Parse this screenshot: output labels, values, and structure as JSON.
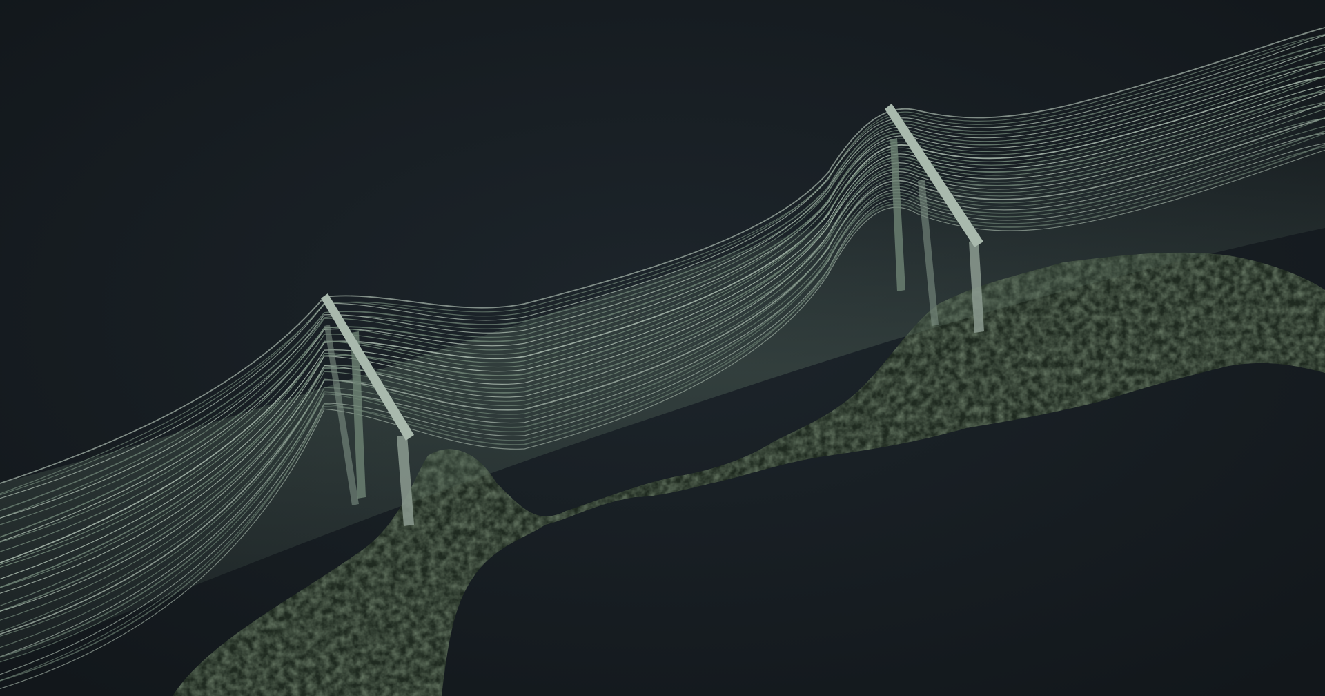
{
  "scene": {
    "subject": "wire-suspension-bridge-over-moss",
    "colors": {
      "background": "#161c21",
      "background_glow": "#1d252b",
      "moss_dark": "#1f2a20",
      "moss_mid": "#2d3b2b",
      "moss_light": "#3f5139",
      "wire": "#a9b9ad",
      "wire_dim": "#6f8476",
      "tower": "#8d9c92",
      "deck_haze": "#5d7263"
    }
  }
}
